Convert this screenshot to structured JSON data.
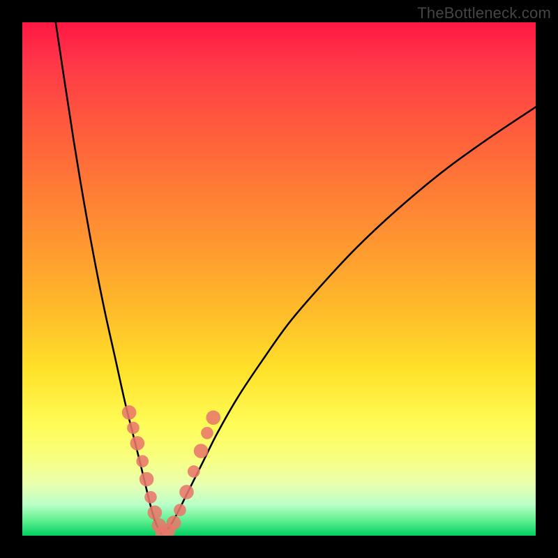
{
  "watermark": "TheBottleneck.com",
  "chart_data": {
    "type": "line",
    "title": "",
    "xlabel": "",
    "ylabel": "",
    "xlim": [
      0,
      100
    ],
    "ylim": [
      0,
      100
    ],
    "series": [
      {
        "name": "left-curve",
        "x": [
          6.5,
          8,
          10,
          12,
          14,
          16,
          18,
          20,
          21.5,
          23,
          24.2,
          25.2,
          26,
          26.7,
          27.3
        ],
        "y": [
          100,
          90,
          77,
          65,
          54,
          44,
          35,
          26,
          20,
          14,
          9,
          5,
          2.5,
          1,
          0.3
        ]
      },
      {
        "name": "right-curve",
        "x": [
          27.3,
          28.5,
          30,
          32,
          35,
          38,
          42,
          47,
          52,
          58,
          65,
          73,
          82,
          91,
          100
        ],
        "y": [
          0.3,
          1.5,
          4,
          8,
          14,
          20,
          27,
          34.5,
          41.5,
          48.5,
          56,
          63.5,
          71,
          77.5,
          83.5
        ]
      }
    ],
    "markers": [
      {
        "series": "left-curve",
        "x": 20.8,
        "y": 24,
        "r": 1.4
      },
      {
        "series": "left-curve",
        "x": 21.6,
        "y": 21,
        "r": 1.2
      },
      {
        "series": "left-curve",
        "x": 22.4,
        "y": 18,
        "r": 1.4
      },
      {
        "series": "left-curve",
        "x": 23.4,
        "y": 14.5,
        "r": 1.2
      },
      {
        "series": "left-curve",
        "x": 24.2,
        "y": 11,
        "r": 1.4
      },
      {
        "series": "left-curve",
        "x": 25.0,
        "y": 7.5,
        "r": 1.2
      },
      {
        "series": "left-curve",
        "x": 25.8,
        "y": 4.5,
        "r": 1.4
      },
      {
        "series": "left-curve",
        "x": 26.6,
        "y": 2.0,
        "r": 1.4
      },
      {
        "series": "left-curve",
        "x": 27.3,
        "y": 0.5,
        "r": 1.4
      },
      {
        "series": "right-curve",
        "x": 28.4,
        "y": 1.0,
        "r": 1.4
      },
      {
        "series": "right-curve",
        "x": 29.5,
        "y": 2.5,
        "r": 1.4
      },
      {
        "series": "right-curve",
        "x": 30.7,
        "y": 5.0,
        "r": 1.2
      },
      {
        "series": "right-curve",
        "x": 32.0,
        "y": 8.5,
        "r": 1.4
      },
      {
        "series": "right-curve",
        "x": 33.4,
        "y": 12.5,
        "r": 1.2
      },
      {
        "series": "right-curve",
        "x": 34.8,
        "y": 16.5,
        "r": 1.4
      },
      {
        "series": "right-curve",
        "x": 36.0,
        "y": 20.0,
        "r": 1.2
      },
      {
        "series": "right-curve",
        "x": 37.2,
        "y": 23.0,
        "r": 1.4
      }
    ],
    "colors": {
      "curve": "#000000",
      "marker": "#e8786b",
      "gradient_top": "#ff1744",
      "gradient_bottom": "#00d060"
    }
  }
}
